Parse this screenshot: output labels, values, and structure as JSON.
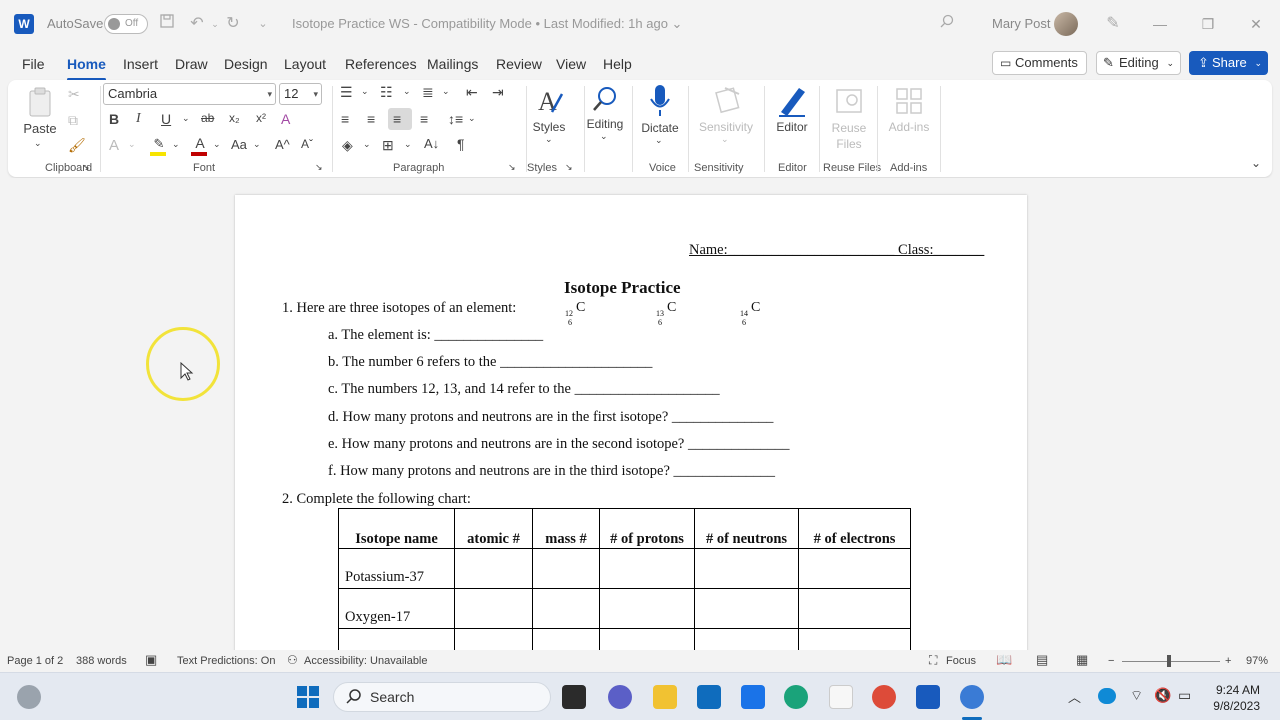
{
  "titlebar": {
    "autosave_label": "AutoSave",
    "autosave_state": "Off",
    "document_title": "Isotope Practice WS  -  Compatibility Mode  •  Last Modified: 1h ago ⌄",
    "user_name": "Mary Post"
  },
  "menu": {
    "tabs": [
      "File",
      "Home",
      "Insert",
      "Draw",
      "Design",
      "Layout",
      "References",
      "Mailings",
      "Review",
      "View",
      "Help"
    ],
    "active_tab": "Home",
    "comments_label": "Comments",
    "editing_label": "Editing",
    "share_label": "Share"
  },
  "ribbon": {
    "paste_label": "Paste",
    "font_name": "Cambria",
    "font_size": "12",
    "styles_label": "Styles",
    "editing_label": "Editing",
    "dictate_label": "Dictate",
    "sensitivity_label": "Sensitivity",
    "editor_label": "Editor",
    "reuse_files_label": "Reuse Files",
    "addins_label": "Add-ins",
    "groups": {
      "clipboard": "Clipboard",
      "font": "Font",
      "paragraph": "Paragraph",
      "styles": "Styles",
      "voice": "Voice",
      "sensitivity": "Sensitivity",
      "editor": "Editor",
      "reuse_files": "Reuse Files",
      "addins": "Add-ins"
    }
  },
  "document": {
    "header_line": "Name:_______________________ Class:_______",
    "title": "Isotope Practice",
    "q1_text": "1.   Here are three isotopes of an element:",
    "isotopes": [
      {
        "mass": "12",
        "atomic": "6",
        "symbol": "C"
      },
      {
        "mass": "13",
        "atomic": "6",
        "symbol": "C"
      },
      {
        "mass": "14",
        "atomic": "6",
        "symbol": "C"
      }
    ],
    "sub_items": [
      "a.   The element is: _______________",
      "b.   The number 6 refers to the _____________________",
      "c.   The numbers 12, 13, and 14 refer to the ____________________",
      "d.   How many protons and neutrons are in the first isotope?  ______________",
      "e.   How many protons and neutrons are in the second isotope?  ______________",
      "f.   How many protons and neutrons are in the third isotope?  ______________"
    ],
    "q2_text": "2.   Complete the following chart:",
    "table": {
      "headers": [
        "Isotope name",
        "atomic #",
        "mass #",
        "# of protons",
        "# of neutrons",
        "# of electrons"
      ],
      "rows": [
        [
          "Potassium-37",
          "",
          "",
          "",
          "",
          ""
        ],
        [
          "Oxygen-17",
          "",
          "",
          "",
          "",
          ""
        ],
        [
          "",
          "",
          "",
          "",
          "",
          ""
        ]
      ]
    }
  },
  "statusbar": {
    "page": "Page 1 of 2",
    "words": "388 words",
    "text_predictions": "Text Predictions: On",
    "accessibility": "Accessibility: Unavailable",
    "focus": "Focus",
    "zoom": "97%"
  },
  "taskbar": {
    "search_label": "Search",
    "time": "9:24 AM",
    "date": "9/8/2023"
  },
  "colors": {
    "accent": "#185abd",
    "cursor_highlight": "#f2e33a"
  }
}
